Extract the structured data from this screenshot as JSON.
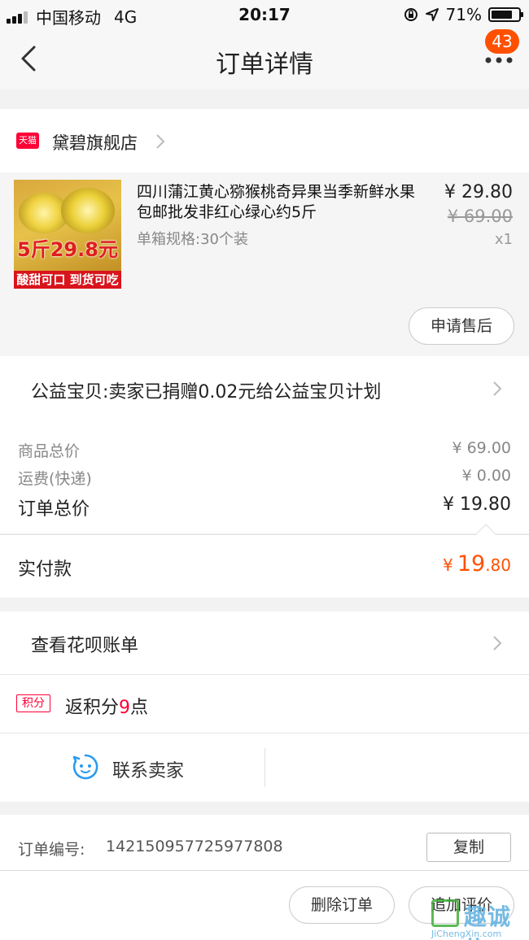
{
  "status_bar": {
    "carrier": "中国移动",
    "network": "4G",
    "time": "20:17",
    "battery": "71%"
  },
  "nav": {
    "title": "订单详情",
    "badge_count": "43"
  },
  "shop": {
    "platform_tag": "天猫",
    "name": "黛碧旗舰店"
  },
  "product": {
    "title": "四川蒲江黄心猕猴桃奇异果当季新鲜水果包邮批发非红心绿心约5斤",
    "spec": "单箱规格:30个装",
    "price": "¥ 29.80",
    "original_price": "¥ 69.00",
    "quantity": "x1",
    "image_promo": "5斤29.8元",
    "image_banner": "酸甜可口 到货可吃",
    "after_sale_label": "申请售后"
  },
  "charity": {
    "text": "公益宝贝:卖家已捐赠0.02元给公益宝贝计划"
  },
  "totals": {
    "goods_label": "商品总价",
    "goods_value": "¥ 69.00",
    "shipping_label": "运费(快递)",
    "shipping_value": "¥ 0.00",
    "order_total_label": "订单总价",
    "order_total_value": "¥ 19.80"
  },
  "paid": {
    "label": "实付款",
    "currency": "¥",
    "integer": "19",
    "decimal": ".80"
  },
  "huabei": {
    "label": "查看花呗账单"
  },
  "points": {
    "tag": "积分",
    "prefix": "返积分",
    "number": "9",
    "suffix": "点"
  },
  "contact": {
    "label": "联系卖家"
  },
  "order_info": {
    "number_label": "订单编号:",
    "number_value": "142150957725977808",
    "copy_label": "复制"
  },
  "bottom_bar": {
    "delete_label": "删除订单",
    "review_label": "追加评价"
  },
  "watermark": {
    "text": "趣诚信",
    "url": "JiChengXin.com"
  },
  "colors": {
    "accent_orange": "#ff5000",
    "tmall_red": "#ff0036",
    "contact_blue": "#2a9bf0"
  }
}
